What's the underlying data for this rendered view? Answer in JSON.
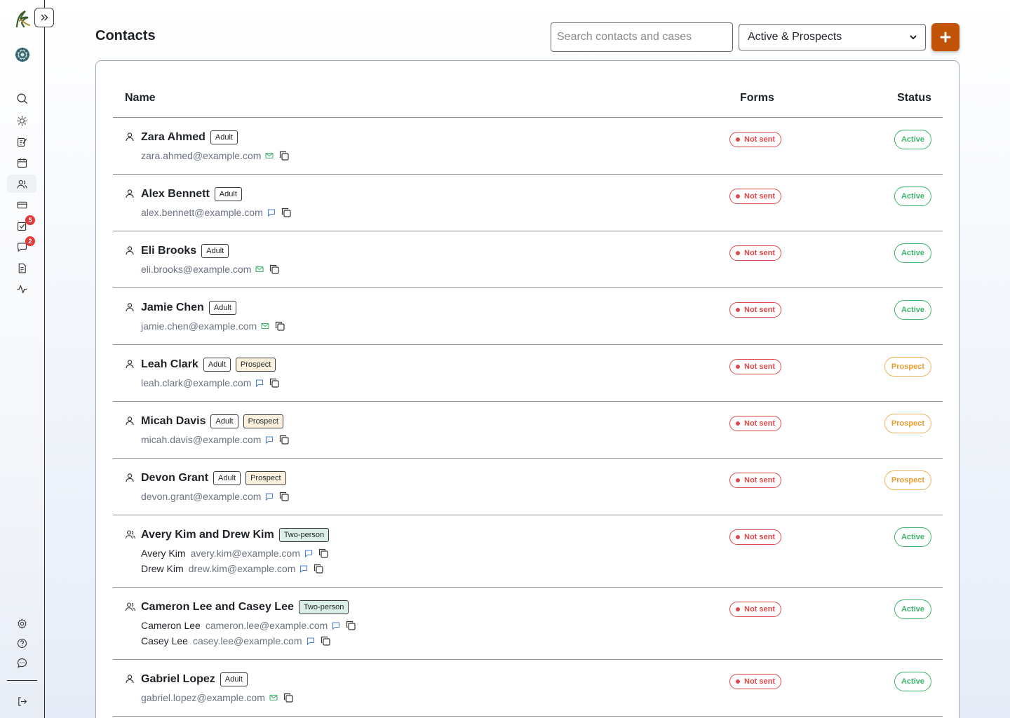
{
  "sidebar": {
    "expand_icon": "chevron-double-right-icon",
    "nav": [
      {
        "name": "search",
        "icon": "search-icon"
      },
      {
        "name": "today",
        "icon": "sun-icon"
      },
      {
        "name": "notes",
        "icon": "edit-note-icon"
      },
      {
        "name": "calendar",
        "icon": "calendar-icon"
      },
      {
        "name": "contacts",
        "icon": "users-icon",
        "active": true
      },
      {
        "name": "billing",
        "icon": "credit-card-icon"
      },
      {
        "name": "tasks",
        "icon": "check-square-icon",
        "badge": "5"
      },
      {
        "name": "messages",
        "icon": "message-icon",
        "badge": "2"
      },
      {
        "name": "documents",
        "icon": "document-icon"
      },
      {
        "name": "activity",
        "icon": "activity-icon"
      }
    ],
    "footer": [
      {
        "name": "settings",
        "icon": "gear-icon"
      },
      {
        "name": "help",
        "icon": "help-circle-icon"
      },
      {
        "name": "feedback",
        "icon": "chat-bubble-icon"
      },
      {
        "name": "logout",
        "icon": "logout-icon"
      }
    ]
  },
  "header": {
    "title": "Contacts",
    "search_placeholder": "Search contacts and cases",
    "filter_selected": "Active & Prospects",
    "add_icon": "plus-icon"
  },
  "table": {
    "columns": {
      "name": "Name",
      "forms": "Forms",
      "status": "Status"
    },
    "rows": [
      {
        "name": "Zara Ahmed",
        "tags": [
          "Adult"
        ],
        "emails": [
          {
            "email": "zara.ahmed@example.com",
            "icon": "mail-icon"
          }
        ],
        "forms": "Not sent",
        "status": "Active"
      },
      {
        "name": "Alex Bennett",
        "tags": [
          "Adult"
        ],
        "emails": [
          {
            "email": "alex.bennett@example.com",
            "icon": "message-icon"
          }
        ],
        "forms": "Not sent",
        "status": "Active"
      },
      {
        "name": "Eli Brooks",
        "tags": [
          "Adult"
        ],
        "emails": [
          {
            "email": "eli.brooks@example.com",
            "icon": "mail-icon"
          }
        ],
        "forms": "Not sent",
        "status": "Active"
      },
      {
        "name": "Jamie Chen",
        "tags": [
          "Adult"
        ],
        "emails": [
          {
            "email": "jamie.chen@example.com",
            "icon": "mail-icon"
          }
        ],
        "forms": "Not sent",
        "status": "Active"
      },
      {
        "name": "Leah Clark",
        "tags": [
          "Adult",
          "Prospect"
        ],
        "emails": [
          {
            "email": "leah.clark@example.com",
            "icon": "message-icon"
          }
        ],
        "forms": "Not sent",
        "status": "Prospect"
      },
      {
        "name": "Micah Davis",
        "tags": [
          "Adult",
          "Prospect"
        ],
        "emails": [
          {
            "email": "micah.davis@example.com",
            "icon": "message-icon"
          }
        ],
        "forms": "Not sent",
        "status": "Prospect"
      },
      {
        "name": "Devon Grant",
        "tags": [
          "Adult",
          "Prospect"
        ],
        "emails": [
          {
            "email": "devon.grant@example.com",
            "icon": "message-icon"
          }
        ],
        "forms": "Not sent",
        "status": "Prospect"
      },
      {
        "name": "Avery Kim and Drew Kim",
        "tags": [
          "Two-person"
        ],
        "group": true,
        "emails": [
          {
            "member": "Avery Kim",
            "email": "avery.kim@example.com",
            "icon": "message-icon"
          },
          {
            "member": "Drew Kim",
            "email": "drew.kim@example.com",
            "icon": "message-icon"
          }
        ],
        "forms": "Not sent",
        "status": "Active"
      },
      {
        "name": "Cameron Lee and Casey Lee",
        "tags": [
          "Two-person"
        ],
        "group": true,
        "emails": [
          {
            "member": "Cameron Lee",
            "email": "cameron.lee@example.com",
            "icon": "message-icon"
          },
          {
            "member": "Casey Lee",
            "email": "casey.lee@example.com",
            "icon": "message-icon"
          }
        ],
        "forms": "Not sent",
        "status": "Active"
      },
      {
        "name": "Gabriel Lopez",
        "tags": [
          "Adult"
        ],
        "emails": [
          {
            "email": "gabriel.lopez@example.com",
            "icon": "mail-icon"
          }
        ],
        "forms": "Not sent",
        "status": "Active"
      }
    ]
  },
  "colors": {
    "accent": "#c2540a",
    "not_sent": "#e0484c",
    "active": "#3bb36a",
    "prospect": "#e79b2d",
    "badge": "#e5383b"
  }
}
